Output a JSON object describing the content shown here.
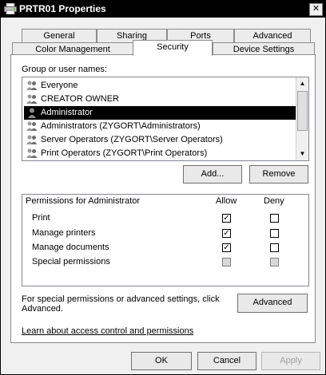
{
  "window": {
    "title": "PRTR01 Properties",
    "close_glyph": "✕",
    "icon": "printer-icon"
  },
  "tabs_row1": [
    {
      "label": "General"
    },
    {
      "label": "Sharing"
    },
    {
      "label": "Ports"
    },
    {
      "label": "Advanced"
    }
  ],
  "tabs_row2": [
    {
      "label": "Color Management"
    },
    {
      "label": "Security",
      "active": true
    },
    {
      "label": "Device Settings"
    }
  ],
  "security": {
    "group_label": "Group or user names:",
    "users": [
      {
        "name": "Everyone",
        "icon": "group-icon"
      },
      {
        "name": "CREATOR OWNER",
        "icon": "group-icon"
      },
      {
        "name": "Administrator",
        "icon": "user-icon",
        "selected": true
      },
      {
        "name": "Administrators (ZYGORT\\Administrators)",
        "icon": "group-icon"
      },
      {
        "name": "Server Operators (ZYGORT\\Server Operators)",
        "icon": "group-icon"
      },
      {
        "name": "Print Operators (ZYGORT\\Print Operators)",
        "icon": "group-icon"
      }
    ],
    "add_label": "Add...",
    "remove_label": "Remove",
    "permissions_label": "Permissions for Administrator",
    "allow_label": "Allow",
    "deny_label": "Deny",
    "permissions": [
      {
        "name": "Print",
        "allow": true,
        "deny": false,
        "disabled": false
      },
      {
        "name": "Manage printers",
        "allow": true,
        "deny": false,
        "disabled": false
      },
      {
        "name": "Manage documents",
        "allow": true,
        "deny": false,
        "disabled": false
      },
      {
        "name": "Special permissions",
        "allow": false,
        "deny": false,
        "disabled": true
      }
    ],
    "advanced_text_line1": "For special permissions or advanced settings, click",
    "advanced_text_line2": "Advanced.",
    "advanced_label": "Advanced",
    "learn_link": "Learn about access control and permissions"
  },
  "footer": {
    "ok_label": "OK",
    "cancel_label": "Cancel",
    "apply_label": "Apply"
  },
  "colors": {
    "selection": "#000000",
    "titlebar": "#000000"
  }
}
